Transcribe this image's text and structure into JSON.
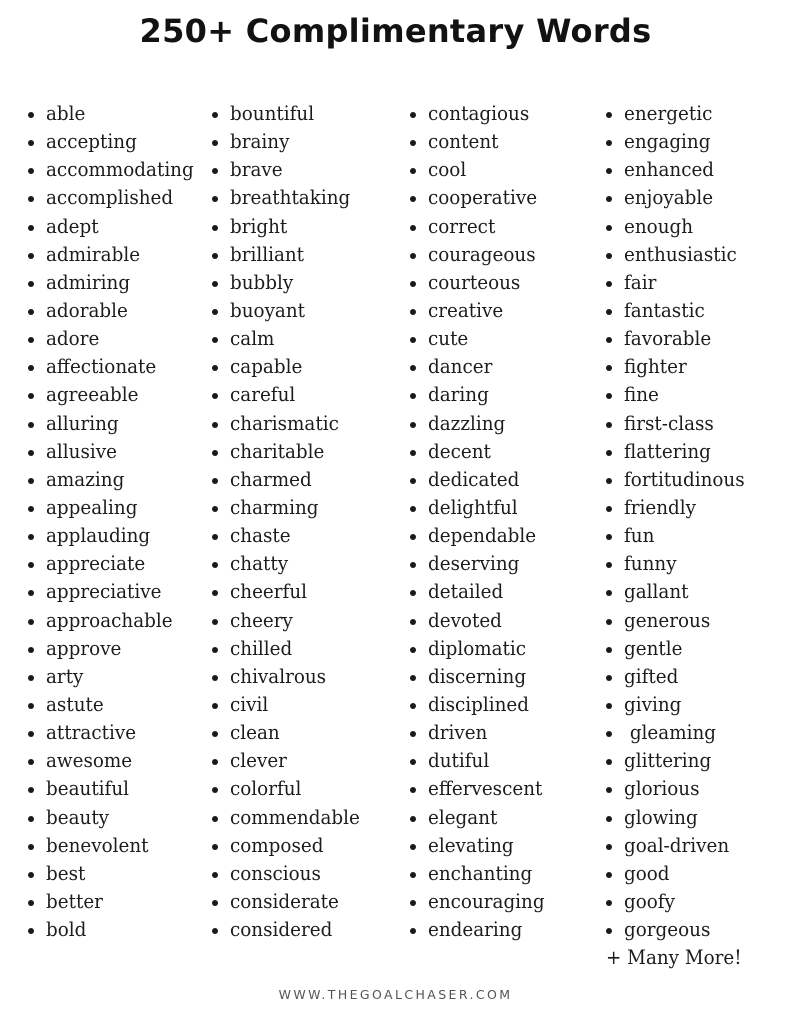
{
  "title": "250+ Complimentary Words",
  "columns": [
    {
      "words": [
        "able",
        "accepting",
        "accommodating",
        "accomplished",
        "adept",
        "admirable",
        "admiring",
        "adorable",
        "adore",
        "affectionate",
        "agreeable",
        "alluring",
        "allusive",
        "amazing",
        "appealing",
        "applauding",
        "appreciate",
        "appreciative",
        "approachable",
        "approve",
        "arty",
        "astute",
        "attractive",
        "awesome",
        "beautiful",
        "beauty",
        "benevolent",
        "best",
        "better",
        "bold"
      ]
    },
    {
      "words": [
        "bountiful",
        "brainy",
        "brave",
        "breathtaking",
        "bright",
        "brilliant",
        "bubbly",
        "buoyant",
        "calm",
        "capable",
        "careful",
        "charismatic",
        "charitable",
        "charmed",
        "charming",
        "chaste",
        "chatty",
        "cheerful",
        "cheery",
        "chilled",
        "chivalrous",
        "civil",
        "clean",
        "clever",
        "colorful",
        "commendable",
        "composed",
        "conscious",
        "considerate",
        "considered"
      ]
    },
    {
      "words": [
        "contagious",
        "content",
        "cool",
        "cooperative",
        "correct",
        "courageous",
        "courteous",
        "creative",
        "cute",
        "dancer",
        "daring",
        "dazzling",
        "decent",
        "dedicated",
        "delightful",
        "dependable",
        "deserving",
        "detailed",
        "devoted",
        "diplomatic",
        "discerning",
        "disciplined",
        "driven",
        "dutiful",
        "effervescent",
        "elegant",
        "elevating",
        "enchanting",
        "encouraging",
        "endearing"
      ]
    },
    {
      "words": [
        "energetic",
        "engaging",
        "enhanced",
        "enjoyable",
        "enough",
        "enthusiastic",
        "fair",
        "fantastic",
        "favorable",
        "fighter",
        "fine",
        "first-class",
        "flattering",
        "fortitudinous",
        "friendly",
        "fun",
        "funny",
        "gallant",
        "generous",
        "gentle",
        "gifted",
        "giving",
        " gleaming",
        "glittering",
        "glorious",
        "glowing",
        "goal-driven",
        "good",
        "goofy",
        "gorgeous"
      ]
    }
  ],
  "many_more": "+ Many More!",
  "footer": "WWW.THEGOALCHASER.COM"
}
